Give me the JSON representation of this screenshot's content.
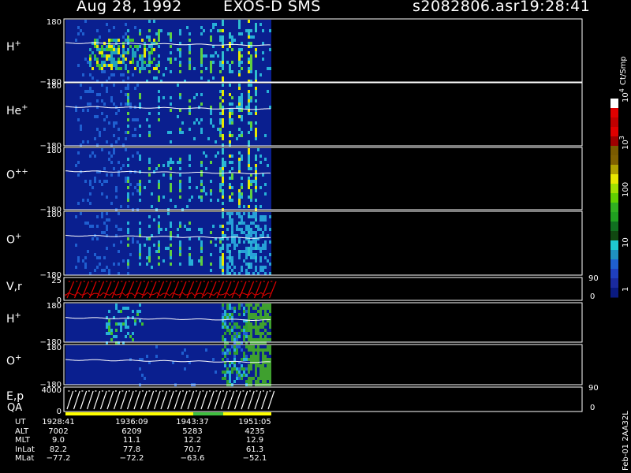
{
  "header": {
    "date": "Aug 28, 1992",
    "instrument": "EXOS-D SMS",
    "file": "s2082806.asr",
    "time": "19:28:41"
  },
  "colorbar": {
    "label": "Ct/Smp",
    "ticks": [
      "1",
      "10",
      "100",
      "10",
      "10"
    ],
    "tick_sup": [
      "",
      "",
      "",
      "3",
      "4"
    ]
  },
  "side_note": "Feb-01 2AA32L",
  "chart_data": {
    "type": "heatmap",
    "panels": [
      {
        "name": "H+",
        "label": "H",
        "sup": "+",
        "ymax": "180",
        "ymin": "−180",
        "kind": "spectrogram"
      },
      {
        "name": "He+",
        "label": "He",
        "sup": "+",
        "ymax": "180",
        "ymin": "−180",
        "kind": "spectrogram"
      },
      {
        "name": "O++",
        "label": "O",
        "sup": "++",
        "ymax": "180",
        "ymin": "−180",
        "kind": "spectrogram"
      },
      {
        "name": "O+",
        "label": "O",
        "sup": "+",
        "ymax": "180",
        "ymin": "−180",
        "kind": "spectrogram"
      },
      {
        "name": "V,r",
        "label": "V,r",
        "sup": "",
        "ymax": "25",
        "ymin": "0",
        "right_top": "90",
        "right_bottom": "0",
        "kind": "line"
      },
      {
        "name": "H+",
        "label": "H",
        "sup": "+",
        "ymax": "180",
        "ymin": "−180",
        "kind": "spectrogram"
      },
      {
        "name": "O+",
        "label": "O",
        "sup": "+",
        "ymax": "180",
        "ymin": "−180",
        "kind": "spectrogram"
      },
      {
        "name": "E,p",
        "label": "E,p",
        "label2": "QA",
        "sup": "",
        "ymax": "4000",
        "ymin": "0",
        "right_top": "90",
        "right_bottom": "0",
        "kind": "line"
      }
    ],
    "x_axis": [
      {
        "name": "UT",
        "values": [
          "1928:41",
          "1936:09",
          "1943:37",
          "1951:05"
        ]
      },
      {
        "name": "ALT",
        "values": [
          "7002",
          "6209",
          "5283",
          "4235"
        ]
      },
      {
        "name": "MLT",
        "values": [
          "9.0",
          "11.1",
          "12.2",
          "12.9"
        ]
      },
      {
        "name": "InLat",
        "values": [
          "82.2",
          "77.8",
          "70.7",
          "61.3"
        ]
      },
      {
        "name": "MLat",
        "values": [
          "−77.2",
          "−72.2",
          "−63.6",
          "−52.1"
        ]
      }
    ]
  }
}
